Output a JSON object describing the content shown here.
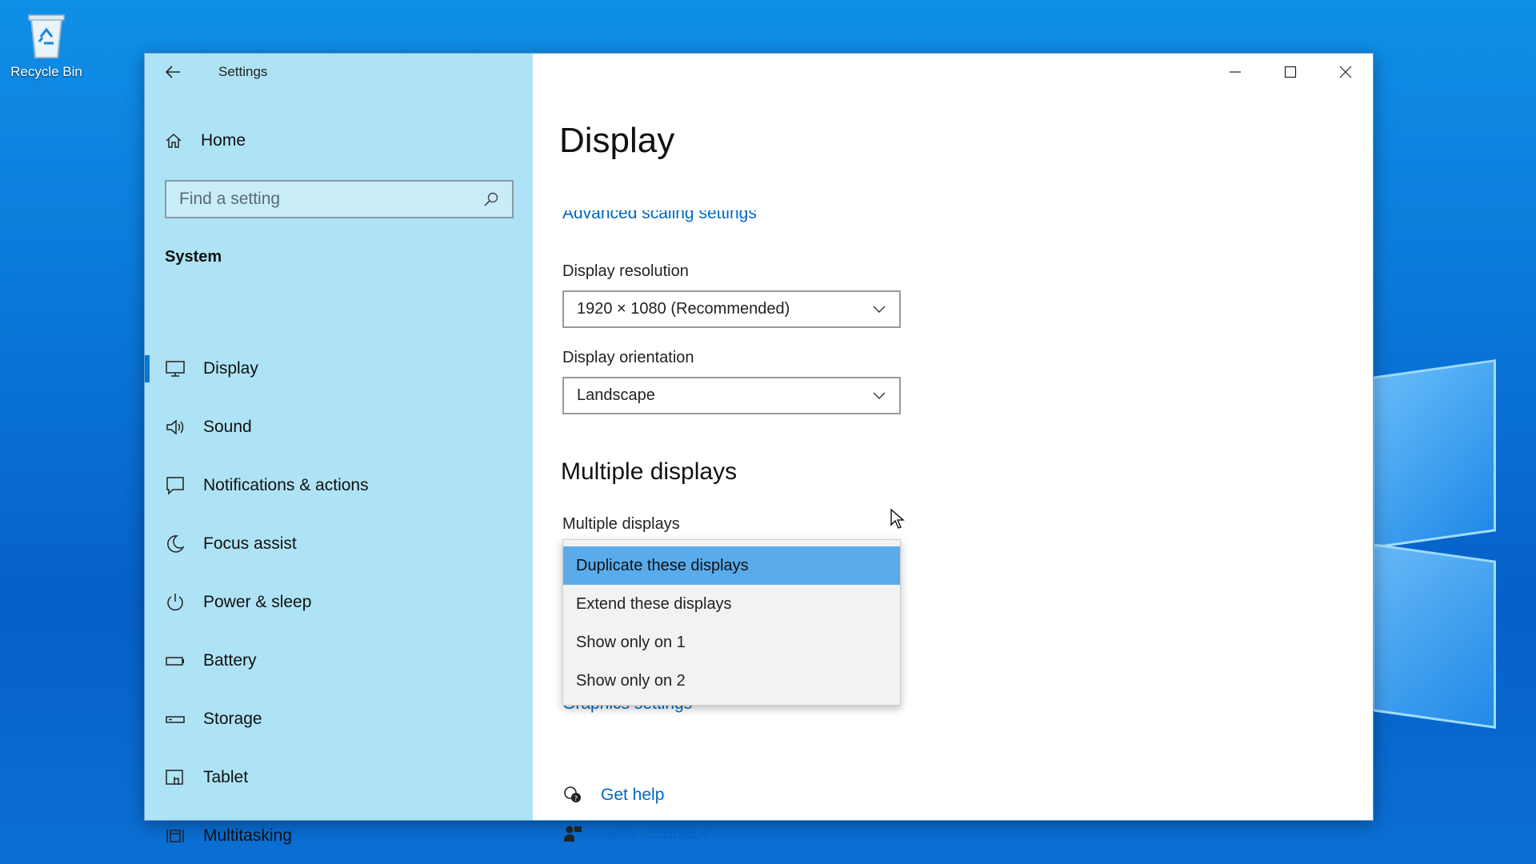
{
  "desktop": {
    "recycle_bin_label": "Recycle Bin"
  },
  "window": {
    "app_title": "Settings",
    "controls": [
      "minimize-icon",
      "maximize-icon",
      "close-icon"
    ]
  },
  "sidebar": {
    "home_label": "Home",
    "search_placeholder": "Find a setting",
    "section_label": "System",
    "items": [
      {
        "label": "Display",
        "icon": "monitor-icon",
        "active": true
      },
      {
        "label": "Sound",
        "icon": "speaker-icon"
      },
      {
        "label": "Notifications & actions",
        "icon": "message-icon"
      },
      {
        "label": "Focus assist",
        "icon": "moon-icon"
      },
      {
        "label": "Power & sleep",
        "icon": "power-icon"
      },
      {
        "label": "Battery",
        "icon": "battery-icon"
      },
      {
        "label": "Storage",
        "icon": "storage-icon"
      },
      {
        "label": "Tablet",
        "icon": "tablet-icon"
      },
      {
        "label": "Multitasking",
        "icon": "multitasking-icon"
      }
    ]
  },
  "main": {
    "title": "Display",
    "advanced_scaling_link": "Advanced scaling settings",
    "resolution": {
      "label": "Display resolution",
      "value": "1920 × 1080 (Recommended)"
    },
    "orientation": {
      "label": "Display orientation",
      "value": "Landscape"
    },
    "multiple_heading": "Multiple displays",
    "multiple_label": "Multiple displays",
    "multiple_options": [
      "Duplicate these displays",
      "Extend these displays",
      "Show only on 1",
      "Show only on 2"
    ],
    "multiple_selected": "Duplicate these displays",
    "graphics_link": "Graphics settings",
    "get_help": "Get help",
    "give_feedback": "Give feedback"
  },
  "colors": {
    "accent": "#0078d7",
    "link": "#0067c0",
    "sidebar_bg": "#aee3f5",
    "menu_selected": "#5aabeb"
  }
}
